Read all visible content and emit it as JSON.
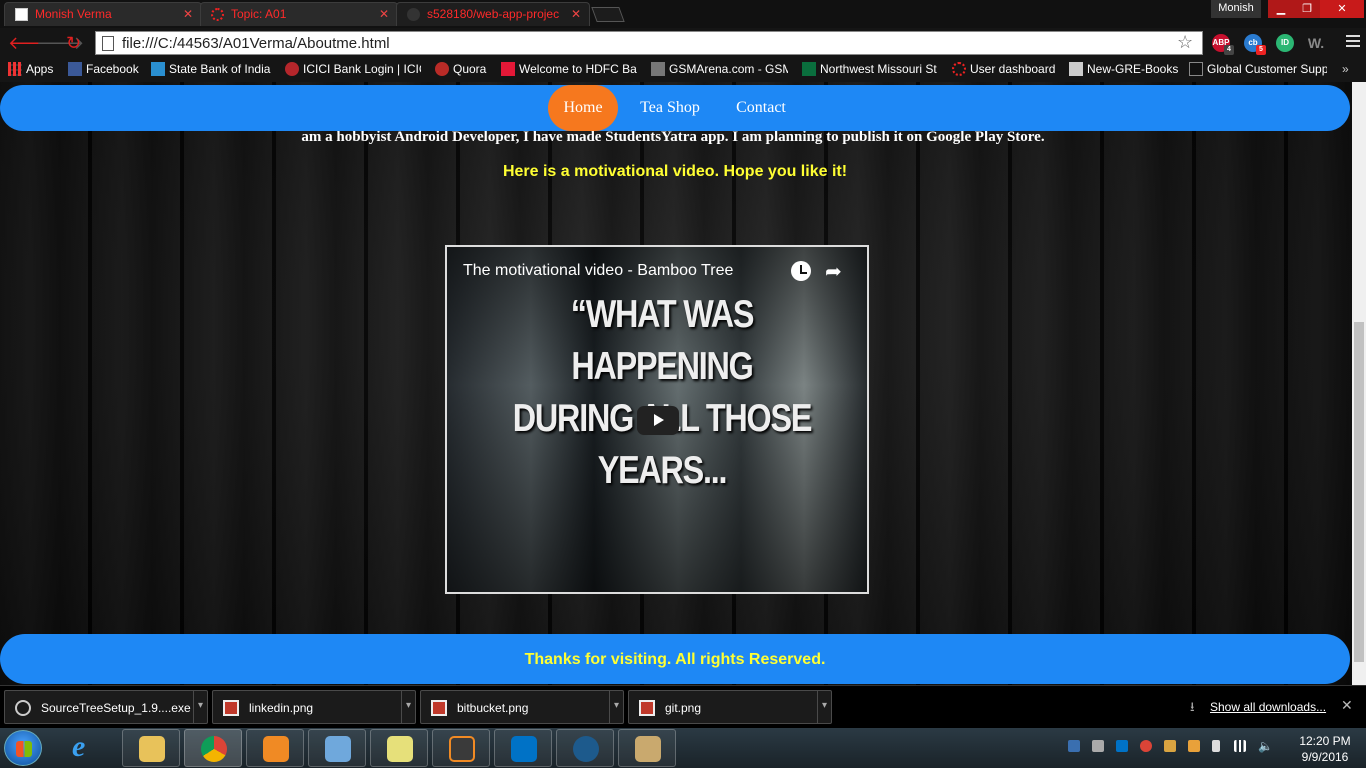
{
  "tabs": [
    {
      "title": "Monish Verma"
    },
    {
      "title": "Topic: A01"
    },
    {
      "title": "s528180/web-app-projec"
    }
  ],
  "profile_name": "Monish",
  "address_bar": {
    "url": "file:///C:/44563/A01Verma/Aboutme.html"
  },
  "extensions": [
    {
      "name": "abp-icon",
      "label": "ABP",
      "badge": "4",
      "color": "#c8102e"
    },
    {
      "name": "cb-icon",
      "label": "cb",
      "badge": "5",
      "color": "#2a7bd0"
    },
    {
      "name": "id-icon",
      "label": "ID",
      "color": "#2bb673"
    },
    {
      "name": "w-icon",
      "label": "W.",
      "color": "#666666"
    }
  ],
  "bookmarks": [
    {
      "label": "Apps"
    },
    {
      "label": "Facebook"
    },
    {
      "label": "State Bank of India"
    },
    {
      "label": "ICICI Bank Login | ICIC"
    },
    {
      "label": "Quora"
    },
    {
      "label": "Welcome to HDFC Ba"
    },
    {
      "label": "GSMArena.com - GSM"
    },
    {
      "label": "Northwest Missouri St"
    },
    {
      "label": "User dashboard"
    },
    {
      "label": "New-GRE-Books"
    },
    {
      "label": "Global Customer Supp"
    }
  ],
  "page": {
    "nav": {
      "home": "Home",
      "tea_shop": "Tea Shop",
      "contact": "Contact"
    },
    "about_text": "am a hobbyist Android Developer, I have made StudentsYatra app. I am planning to publish it on Google Play Store.",
    "video_intro": "Here is a motivational video. Hope you like it!",
    "video": {
      "title": "The motivational video - Bamboo Tree",
      "quote_line1": "“WHAT WAS HAPPENING",
      "quote_line2": "DURING ALL THOSE YEARS..."
    },
    "footer_text": "Thanks for visiting. All rights Reserved."
  },
  "downloads": [
    {
      "name": "SourceTreeSetup_1.9....exe"
    },
    {
      "name": "linkedin.png"
    },
    {
      "name": "bitbucket.png"
    },
    {
      "name": "git.png"
    }
  ],
  "downloads_show_all": "Show all downloads...",
  "taskbar_clock": {
    "time": "12:20 PM",
    "date": "9/9/2016"
  },
  "colors": {
    "nav_blue": "#1e88f5",
    "home_orange": "#f6781e",
    "yellow_text": "#ffff33"
  }
}
